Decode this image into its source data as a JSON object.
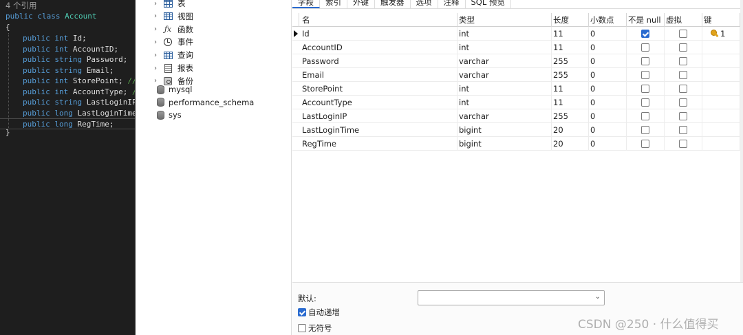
{
  "code": {
    "ref_count": "4 个引用",
    "class_line": {
      "kw": "public class ",
      "name": "Account"
    },
    "open_brace": "{",
    "close_brace": "}",
    "lines": [
      {
        "kw": "public int ",
        "text": "Id;",
        "comment": ""
      },
      {
        "kw": "public int ",
        "text": "AccountID;",
        "comment": ""
      },
      {
        "kw": "public string ",
        "text": "Password;",
        "comment": ""
      },
      {
        "kw": "public string ",
        "text": "Email;",
        "comment": ""
      },
      {
        "kw": "public int ",
        "text": "StorePoint; ",
        "comment": "//积"
      },
      {
        "kw": "public int ",
        "text": "AccountType; ",
        "comment": "//"
      },
      {
        "kw": "public string ",
        "text": "LastLoginIP;",
        "comment": ""
      },
      {
        "kw": "public long ",
        "text": "LastLoginTime;",
        "comment": ""
      },
      {
        "kw": "public long ",
        "text": "RegTime;",
        "comment": ""
      }
    ]
  },
  "tree": {
    "items": [
      {
        "label": "表",
        "icon": "table-grid-icon"
      },
      {
        "label": "视图",
        "icon": "view-grid-icon"
      },
      {
        "label": "函数",
        "icon": "function-fx-icon",
        "glyph": "ƒx"
      },
      {
        "label": "事件",
        "icon": "event-clock-icon"
      },
      {
        "label": "查询",
        "icon": "query-grid-icon"
      },
      {
        "label": "报表",
        "icon": "report-icon"
      },
      {
        "label": "备份",
        "icon": "backup-icon"
      }
    ],
    "databases": [
      "mysql",
      "performance_schema",
      "sys"
    ]
  },
  "tabs": [
    "字段",
    "索引",
    "外键",
    "触发器",
    "选项",
    "注释",
    "SQL 预览"
  ],
  "grid": {
    "headers": {
      "name": "名",
      "type": "类型",
      "length": "长度",
      "decimals": "小数点",
      "not_null": "不是 null",
      "virtual": "虚拟",
      "key": "键"
    },
    "rows": [
      {
        "name": "Id",
        "type": "int",
        "length": "11",
        "decimals": "0",
        "not_null": true,
        "virtual": false,
        "key": "1",
        "current": true
      },
      {
        "name": "AccountID",
        "type": "int",
        "length": "11",
        "decimals": "0",
        "not_null": false,
        "virtual": false,
        "key": ""
      },
      {
        "name": "Password",
        "type": "varchar",
        "length": "255",
        "decimals": "0",
        "not_null": false,
        "virtual": false,
        "key": ""
      },
      {
        "name": "Email",
        "type": "varchar",
        "length": "255",
        "decimals": "0",
        "not_null": false,
        "virtual": false,
        "key": ""
      },
      {
        "name": "StorePoint",
        "type": "int",
        "length": "11",
        "decimals": "0",
        "not_null": false,
        "virtual": false,
        "key": ""
      },
      {
        "name": "AccountType",
        "type": "int",
        "length": "11",
        "decimals": "0",
        "not_null": false,
        "virtual": false,
        "key": ""
      },
      {
        "name": "LastLoginIP",
        "type": "varchar",
        "length": "255",
        "decimals": "0",
        "not_null": false,
        "virtual": false,
        "key": ""
      },
      {
        "name": "LastLoginTime",
        "type": "bigint",
        "length": "20",
        "decimals": "0",
        "not_null": false,
        "virtual": false,
        "key": ""
      },
      {
        "name": "RegTime",
        "type": "bigint",
        "length": "20",
        "decimals": "0",
        "not_null": false,
        "virtual": false,
        "key": ""
      }
    ]
  },
  "props": {
    "default_label": "默认:",
    "default_value": "",
    "auto_increment_label": "自动递增",
    "auto_increment": true,
    "unsigned_label": "无符号",
    "unsigned": false
  },
  "watermark": "CSDN @250 · 什么值得买",
  "colors": {
    "editor_bg": "#1e1e1e",
    "keyword": "#569cd6",
    "class_name": "#4ec9b0",
    "comment": "#57a64a",
    "accent": "#2a6bd0",
    "key_gold": "#e0a31c"
  }
}
